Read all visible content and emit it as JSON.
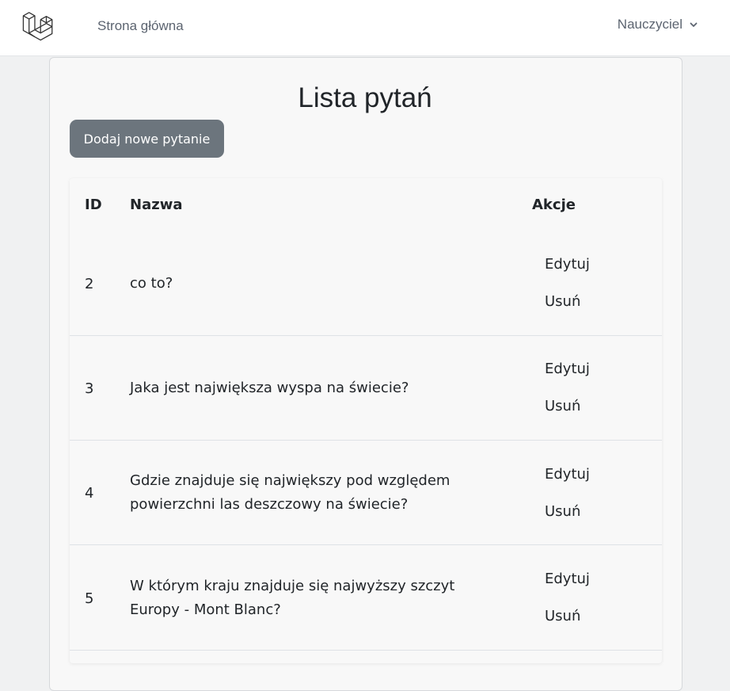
{
  "navbar": {
    "home_link": "Strona główna",
    "user_menu": "Nauczyciel",
    "logo_icon": "laravel-logo-icon",
    "dropdown_icon": "chevron-down-icon"
  },
  "main": {
    "title": "Lista pytań",
    "add_button": "Dodaj nowe pytanie"
  },
  "table": {
    "headers": {
      "id": "ID",
      "name": "Nazwa",
      "actions": "Akcje"
    },
    "rows": [
      {
        "id": "2",
        "name": "co to?",
        "edit": "Edytuj",
        "delete": "Usuń"
      },
      {
        "id": "3",
        "name": "Jaka jest największa wyspa na świecie?",
        "edit": "Edytuj",
        "delete": "Usuń"
      },
      {
        "id": "4",
        "name": "Gdzie znajduje się największy pod względem powierzchni las deszczowy na świecie?",
        "edit": "Edytuj",
        "delete": "Usuń"
      },
      {
        "id": "5",
        "name": "W którym kraju znajduje się najwyższy szczyt Europy - Mont Blanc?",
        "edit": "Edytuj",
        "delete": "Usuń"
      }
    ]
  },
  "colors": {
    "background": "#f0f1f2",
    "button": "#6c757d",
    "text": "#212529",
    "nav_text": "#5c6470"
  }
}
